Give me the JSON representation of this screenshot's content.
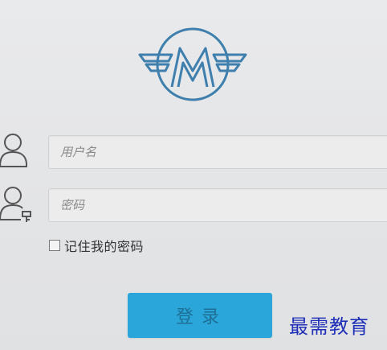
{
  "logo": {
    "icon": "winged-m-emblem-icon",
    "color": "#3f7fad"
  },
  "login_form": {
    "username_placeholder": "用户名",
    "username_value": "",
    "password_placeholder": "密码",
    "password_value": "",
    "remember_label": "记住我的密码",
    "remember_checked": false,
    "login_label": "登录",
    "accent_color": "#2aa6da"
  },
  "watermark": {
    "text": "最需教育",
    "color": "#1f2fb8"
  }
}
